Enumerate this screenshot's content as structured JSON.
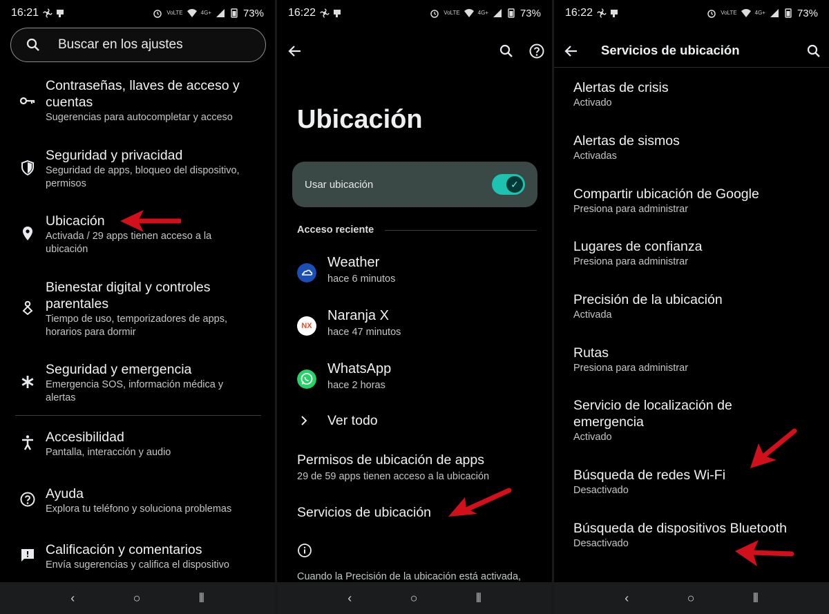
{
  "colors": {
    "arrow": "#d0101a",
    "accent": "#1fc1b1",
    "card": "#3a4846"
  },
  "panel1": {
    "status": {
      "time": "16:21",
      "battery": "73%",
      "net": "4G+",
      "volte": "VoLTE"
    },
    "search": {
      "placeholder": "Buscar en los ajustes",
      "icon": "search-icon"
    },
    "items": [
      {
        "title": "Contraseñas, llaves de acceso y cuentas",
        "sub": "Sugerencias para autocompletar y acceso",
        "icon": "key-icon"
      },
      {
        "title": "Seguridad y privacidad",
        "sub": "Seguridad de apps, bloqueo del dispositivo, permisos",
        "icon": "shield-icon"
      },
      {
        "title": "Ubicación",
        "sub": "Activada / 29 apps tienen acceso a la ubicación",
        "icon": "location-pin-icon"
      },
      {
        "title": "Bienestar digital y controles parentales",
        "sub": "Tiempo de uso, temporizadores de apps, horarios para dormir",
        "icon": "wellbeing-icon"
      },
      {
        "title": "Seguridad y emergencia",
        "sub": "Emergencia SOS, información médica y alertas",
        "icon": "asterisk-icon"
      },
      {
        "title": "Accesibilidad",
        "sub": "Pantalla, interacción y audio",
        "icon": "accessibility-icon"
      },
      {
        "title": "Ayuda",
        "sub": "Explora tu teléfono y soluciona problemas",
        "icon": "help-icon"
      },
      {
        "title": "Calificación y comentarios",
        "sub": "Envía sugerencias y califica el dispositivo",
        "icon": "feedback-icon"
      }
    ]
  },
  "panel2": {
    "status": {
      "time": "16:22",
      "battery": "73%"
    },
    "title": "Ubicación",
    "toggle": {
      "label": "Usar ubicación",
      "on": true
    },
    "recent_header": "Acceso reciente",
    "apps": [
      {
        "name": "Weather",
        "when": "hace 6 minutos",
        "icon": "weather-icon",
        "icon_text": ""
      },
      {
        "name": "Naranja X",
        "when": "hace 47 minutos",
        "icon": "naranja-x-icon",
        "icon_text": "NX"
      },
      {
        "name": "WhatsApp",
        "when": "hace 2 horas",
        "icon": "whatsapp-icon",
        "icon_text": ""
      }
    ],
    "see_all": "Ver todo",
    "app_perms": {
      "title": "Permisos de ubicación de apps",
      "sub": "29 de 59 apps tienen acceso a la ubicación"
    },
    "services": "Servicios de ubicación",
    "footer": "Cuando la Precisión de la ubicación está activada, las apps y los servicios obtienen una ubicación más precisa. Para ello, Google procesa de forma periódica información..."
  },
  "panel3": {
    "status": {
      "time": "16:22",
      "battery": "73%"
    },
    "title": "Servicios de ubicación",
    "items": [
      {
        "title": "Alertas de crisis",
        "sub": "Activado"
      },
      {
        "title": "Alertas de sismos",
        "sub": "Activadas"
      },
      {
        "title": "Compartir ubicación de Google",
        "sub": "Presiona para administrar"
      },
      {
        "title": "Lugares de confianza",
        "sub": "Presiona para administrar"
      },
      {
        "title": "Precisión de la ubicación",
        "sub": "Activada"
      },
      {
        "title": "Rutas",
        "sub": "Presiona para administrar"
      },
      {
        "title": "Servicio de localización de emergencia",
        "sub": "Activado"
      },
      {
        "title": "Búsqueda de redes Wi-Fi",
        "sub": "Desactivado"
      },
      {
        "title": "Búsqueda de dispositivos Bluetooth",
        "sub": "Desactivado"
      }
    ]
  },
  "navbar": {
    "back": "‹",
    "home": "○",
    "recents": "⦀"
  }
}
